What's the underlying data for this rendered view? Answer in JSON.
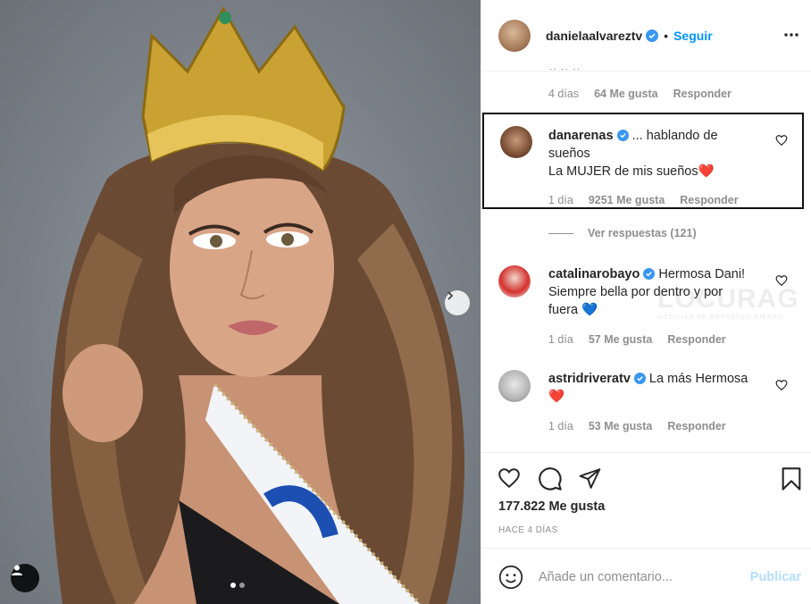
{
  "post": {
    "username": "danielaalvareztv",
    "follow_label": "Seguir",
    "separator": "•",
    "more_icon": "more-horizontal-icon"
  },
  "top_comment_meta": {
    "time": "4 días",
    "likes": "64 Me gusta",
    "reply": "Responder"
  },
  "comments": [
    {
      "username": "danarenas",
      "text_line1": " ... hablando de",
      "text_line2": "sueños",
      "text_line3": "La MUJER de mis sueños",
      "emoji": "❤️",
      "time": "1 día",
      "likes": "9251 Me gusta",
      "reply": "Responder"
    },
    {
      "username": "catalinarobayo",
      "text_line1": " Hermosa Dani!",
      "text_line2": "Siempre bella por dentro y por",
      "text_line3": "fuera ",
      "emoji": "💙",
      "time": "1 día",
      "likes": "57 Me gusta",
      "reply": "Responder"
    },
    {
      "username": "astridriveratv",
      "text_line1": " La más Hermosa",
      "emoji": "❤️",
      "time": "1 día",
      "likes": "53 Me gusta",
      "reply": "Responder"
    }
  ],
  "view_replies": "Ver respuestas (121)",
  "watermark": {
    "brand": "LOCURAG",
    "tagline": "NOTICIAS DE ENTRETENIMIENTO"
  },
  "stats": {
    "likes": "177.822 Me gusta",
    "posted": "HACE 4 DÍAS"
  },
  "composer": {
    "placeholder": "Añade un comentario...",
    "publish": "Publicar"
  },
  "colors": {
    "accent": "#0095f6",
    "publish_disabled": "#b2dffc",
    "muted": "#8e8e8e",
    "verified": "#3897f0"
  }
}
